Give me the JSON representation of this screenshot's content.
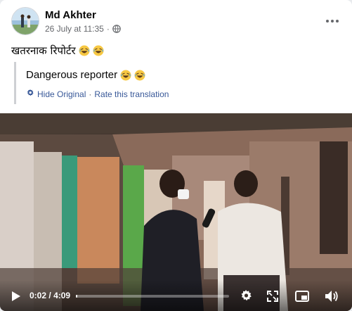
{
  "post": {
    "author": "Md Akhter",
    "timestamp": "26 July at 11:35",
    "separator": "·",
    "caption": "खतरनाक रिपोर्टर",
    "caption_emojis": [
      "laughing-tears-emoji",
      "laughing-tears-emoji"
    ],
    "translation": {
      "text": "Dangerous reporter",
      "hide_label": "Hide Original",
      "separator": "·",
      "rate_label": "Rate this translation"
    }
  },
  "video": {
    "current_time": "0:02",
    "time_separator": "/",
    "duration": "4:09",
    "progress": 0.008
  },
  "colors": {
    "link": "#385898",
    "secondary_text": "#65676b",
    "emoji_face": "#f7c843"
  },
  "icons": [
    "globe-icon",
    "more-options-icon",
    "settings-gear-icon",
    "play-icon",
    "settings-icon",
    "fullscreen-icon",
    "picture-in-picture-icon",
    "volume-icon"
  ]
}
